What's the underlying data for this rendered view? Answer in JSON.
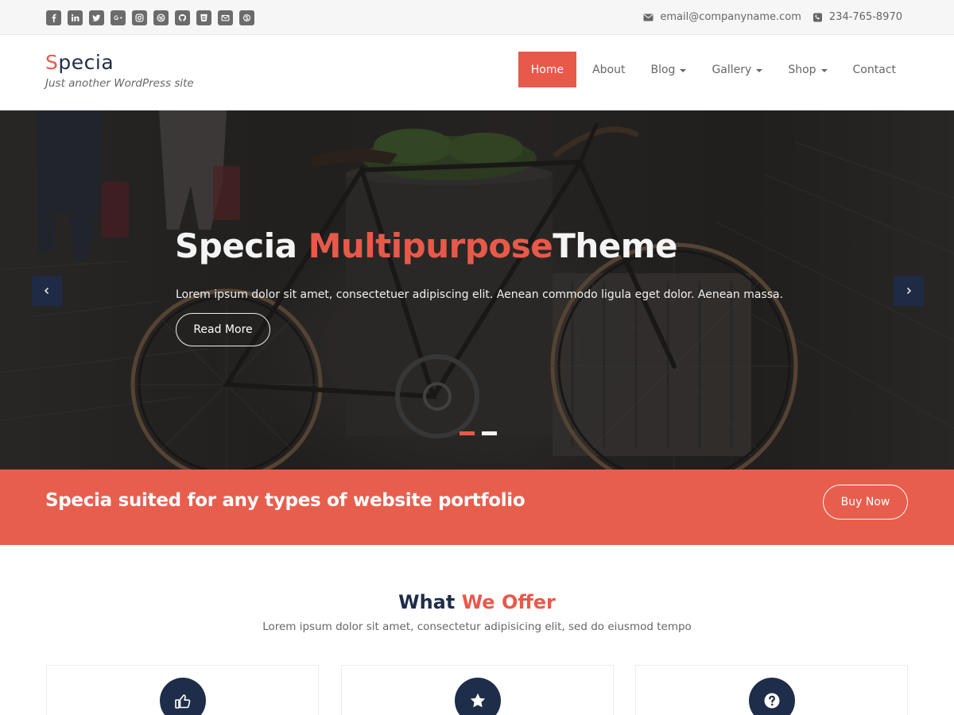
{
  "topbar": {
    "social_icons": [
      "facebook-icon",
      "linkedin-icon",
      "twitter-icon",
      "google-plus-icon",
      "instagram-icon",
      "dribbble-icon",
      "github-icon",
      "html5-icon",
      "envelope-icon",
      "skype-icon"
    ],
    "email": "email@companyname.com",
    "phone": "234-765-8970"
  },
  "header": {
    "logo_first": "S",
    "logo_rest": "pecia",
    "tagline": "Just another WordPress site"
  },
  "nav": {
    "home": "Home",
    "about": "About",
    "blog": "Blog",
    "gallery": "Gallery",
    "shop": "Shop",
    "contact": "Contact",
    "active": "Home"
  },
  "hero": {
    "title_part1": "Specia ",
    "title_accent": "Multipurpose",
    "title_part2": "Theme",
    "description": "Lorem ipsum dolor sit amet, consectetuer adipiscing elit. Aenean commodo ligula eget dolor. Aenean massa.",
    "button": "Read More",
    "slides_total": 2,
    "active_slide": 1
  },
  "cta": {
    "text": "Specia suited for any types of website portfolio",
    "button": "Buy Now"
  },
  "services": {
    "title_part1": "What ",
    "title_accent": "We Offer",
    "subtitle": "Lorem ipsum dolor sit amet, consectetur adipisicing elit, sed do eiusmod tempo",
    "icons": [
      "thumbs-up-icon",
      "star-icon",
      "question-circle-icon"
    ]
  },
  "colors": {
    "accent": "#e8594a",
    "navy": "#1e2d4a"
  }
}
